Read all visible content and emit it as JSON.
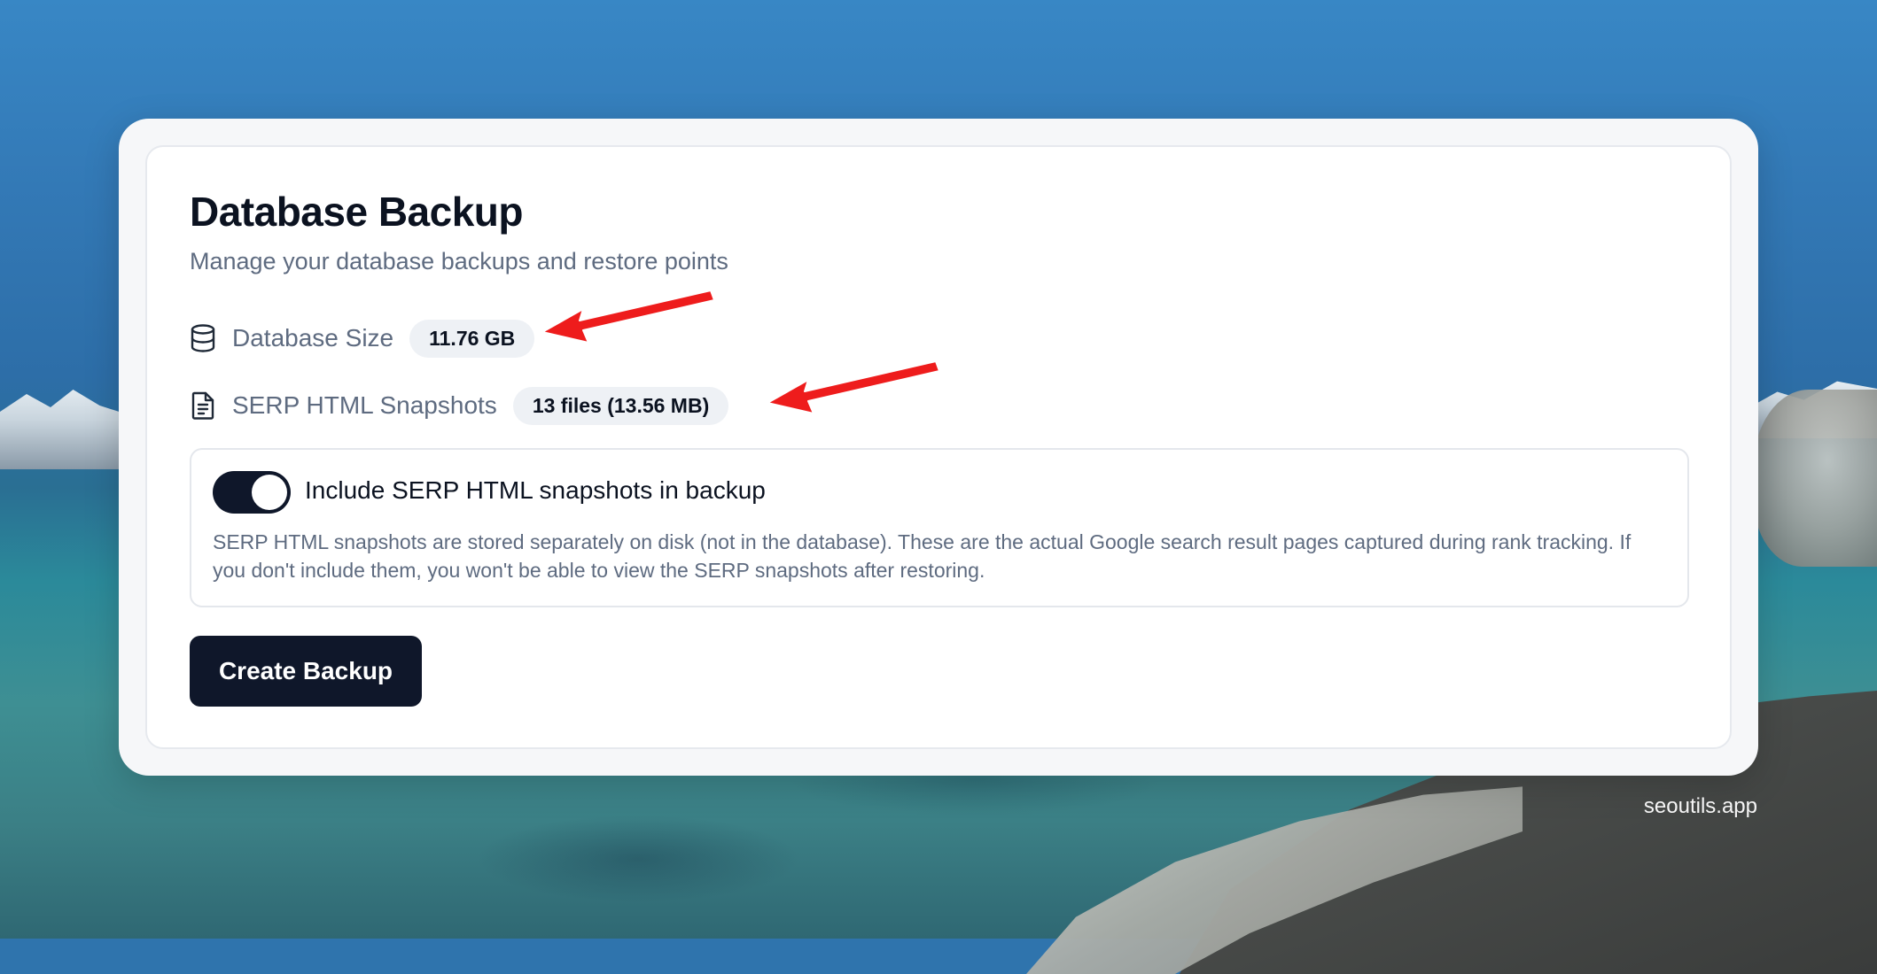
{
  "page": {
    "title": "Database Backup",
    "subtitle": "Manage your database backups and restore points"
  },
  "stats": {
    "database_size": {
      "icon": "database-icon",
      "label": "Database Size",
      "value": "11.76 GB"
    },
    "serp_snapshots": {
      "icon": "file-text-icon",
      "label": "SERP HTML Snapshots",
      "value": "13 files (13.56 MB)"
    }
  },
  "option": {
    "toggle_on": true,
    "label": "Include SERP HTML snapshots in backup",
    "description": "SERP HTML snapshots are stored separately on disk (not in the database). These are the actual Google search result pages captured during rank tracking. If you don't include them, you won't be able to view the SERP snapshots after restoring."
  },
  "actions": {
    "create_backup_label": "Create Backup"
  },
  "watermark": "seoutils.app",
  "colors": {
    "primary": "#0f172a",
    "muted_text": "#5e6b80",
    "badge_bg": "#eef1f5",
    "arrow": "#ee1c1c"
  }
}
